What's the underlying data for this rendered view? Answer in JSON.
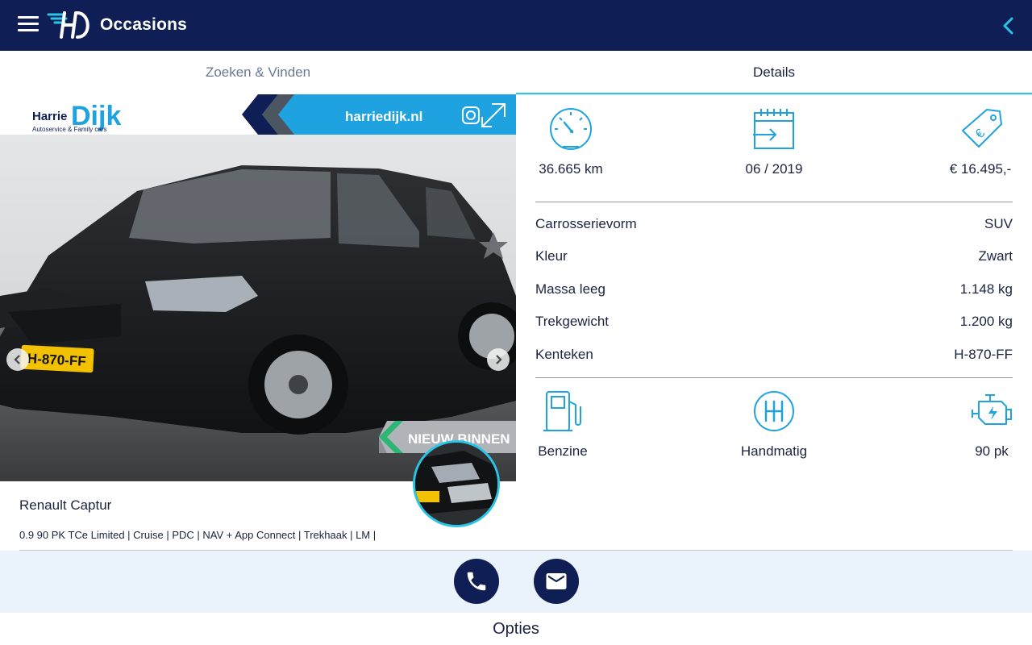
{
  "appbar": {
    "title": "Occasions",
    "bg_color": "#0f1f55",
    "accent_color": "#29c5e6",
    "menu_icon": "hamburger-menu-icon",
    "back_icon": "chevron-left-icon"
  },
  "tabs": [
    {
      "label": "Zoeken & Vinden",
      "active": false
    },
    {
      "label": "Details",
      "active": true
    }
  ],
  "photo": {
    "banner_brand": "Dijk",
    "banner_brand_prefix": "Harrie",
    "banner_tagline": "Autoservice & Family cars",
    "banner_url": "harriedijk.nl",
    "banner_label": "NIEUW BINNEN",
    "license_plate": "H-870-FF"
  },
  "car": {
    "title": "Renault Captur",
    "subtitle": "0.9 90 PK TCe Limited | Cruise | PDC | NAV + App Connect | Trekhaak | LM |"
  },
  "stats_top": [
    {
      "icon": "speedometer-icon",
      "value": "36.665 km"
    },
    {
      "icon": "calendar-icon",
      "value": "06 / 2019"
    },
    {
      "icon": "price-tag-icon",
      "value": "€ 16.495,-"
    }
  ],
  "specs": [
    {
      "label": "Carrosserievorm",
      "value": "SUV"
    },
    {
      "label": "Kleur",
      "value": "Zwart"
    },
    {
      "label": "Massa leeg",
      "value": "1.148 kg"
    },
    {
      "label": "Trekgewicht",
      "value": "1.200 kg"
    },
    {
      "label": "Kenteken",
      "value": "H-870-FF"
    }
  ],
  "stats_bottom": [
    {
      "icon": "fuel-pump-icon",
      "value": "Benzine"
    },
    {
      "icon": "gearbox-icon",
      "value": "Handmatig"
    },
    {
      "icon": "engine-icon",
      "value": "90 pk"
    }
  ],
  "actions": {
    "phone_icon": "phone-icon",
    "mail_icon": "mail-icon",
    "options_label": "Opties"
  }
}
